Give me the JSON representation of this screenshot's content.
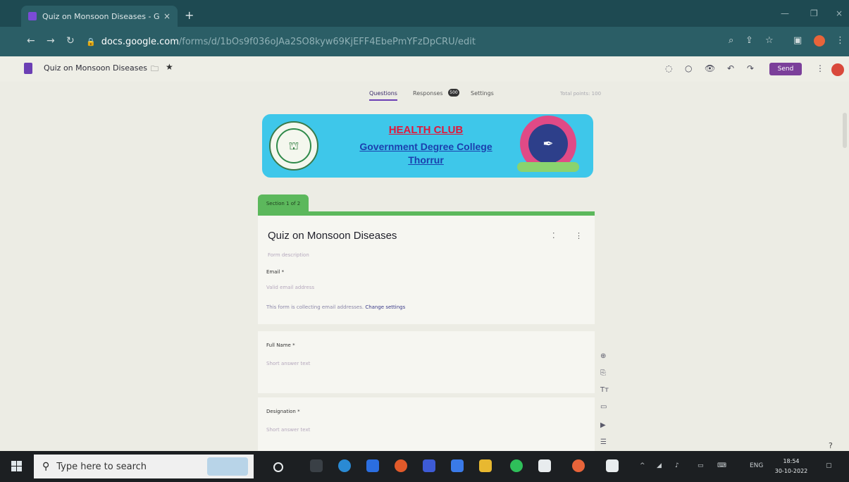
{
  "browser": {
    "tab_title": "Quiz on Monsoon Diseases - G",
    "tab_close": "×",
    "new_tab": "+",
    "url_host": "docs.google.com",
    "url_path": "/forms/d/1bOs9f036oJAa2SO8kyw69KjEFF4EbePmYFzDpCRU/edit",
    "min": "—",
    "restore": "❐",
    "close": "×"
  },
  "forms_header": {
    "doc_title": "Quiz on Monsoon Diseases",
    "send_label": "Send"
  },
  "form_tabs": {
    "questions": "Questions",
    "responses": "Responses",
    "responses_count": "500",
    "settings": "Settings",
    "total_points": "Total points: 100"
  },
  "banner": {
    "line1": "HEALTH CLUB",
    "line2": "Government Degree College",
    "line3": "Thorrur"
  },
  "section": {
    "label": "Section 1 of 2"
  },
  "quiz": {
    "title": "Quiz on Monsoon Diseases",
    "description_placeholder": "Form description"
  },
  "email_block": {
    "label": "Email *",
    "placeholder": "Valid email address",
    "note": "This form is collecting email addresses.",
    "link": "Change settings"
  },
  "q_fullname": {
    "label": "Full Name *",
    "placeholder": "Short answer text"
  },
  "q_designation": {
    "label": "Designation *",
    "placeholder": "Short answer text"
  },
  "taskbar": {
    "search_placeholder": "Type here to search",
    "lang": "ENG",
    "time": "18:54",
    "date": "30-10-2022"
  },
  "colors": {
    "accent": "#6b3fb4",
    "banner_bg": "#3ec7ea",
    "section_green": "#5cb85c",
    "title_red": "#e0183c",
    "title_blue": "#1b3fae"
  }
}
